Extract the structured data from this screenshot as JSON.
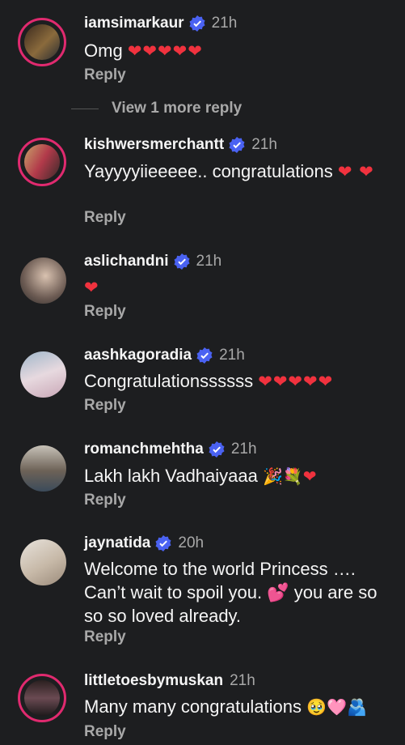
{
  "colors": {
    "background": "#1d1e20",
    "verified": "#4a62f2",
    "heart": "#f0323e",
    "story_ring": "#e02a6f"
  },
  "view_more_replies": "View 1 more reply",
  "comments": [
    {
      "username": "iamsimarkaur",
      "time": "21h",
      "text": "Omg",
      "emoji": "❤❤❤❤❤",
      "reply": "Reply"
    },
    {
      "username": "kishwersmerchantt",
      "time": "21h",
      "text": "Yayyyyiieeeee.. congratulations",
      "emoji": "❤ ❤",
      "reply": "Reply"
    },
    {
      "username": "aslichandni",
      "time": "21h",
      "text": "",
      "emoji": "❤",
      "reply": "Reply"
    },
    {
      "username": "aashkagoradia",
      "time": "21h",
      "text": "Congratulationssssss",
      "emoji": "❤❤❤❤❤",
      "reply": "Reply"
    },
    {
      "username": "romanchmehtha",
      "time": "21h",
      "text": "Lakh lakh Vadhaiyaaa",
      "emoji": "🎉💐❤",
      "reply": "Reply"
    },
    {
      "username": "jaynatida",
      "time": "20h",
      "text": "Welcome to the world Princess …. Can’t wait to spoil you. 💕 you are so so so loved already.",
      "emoji": "",
      "reply": "Reply"
    },
    {
      "username": "littletoesbymuskan",
      "time": "21h",
      "text": "Many many congratulations",
      "emoji": "🥹🩷🫂",
      "reply": "Reply"
    }
  ]
}
